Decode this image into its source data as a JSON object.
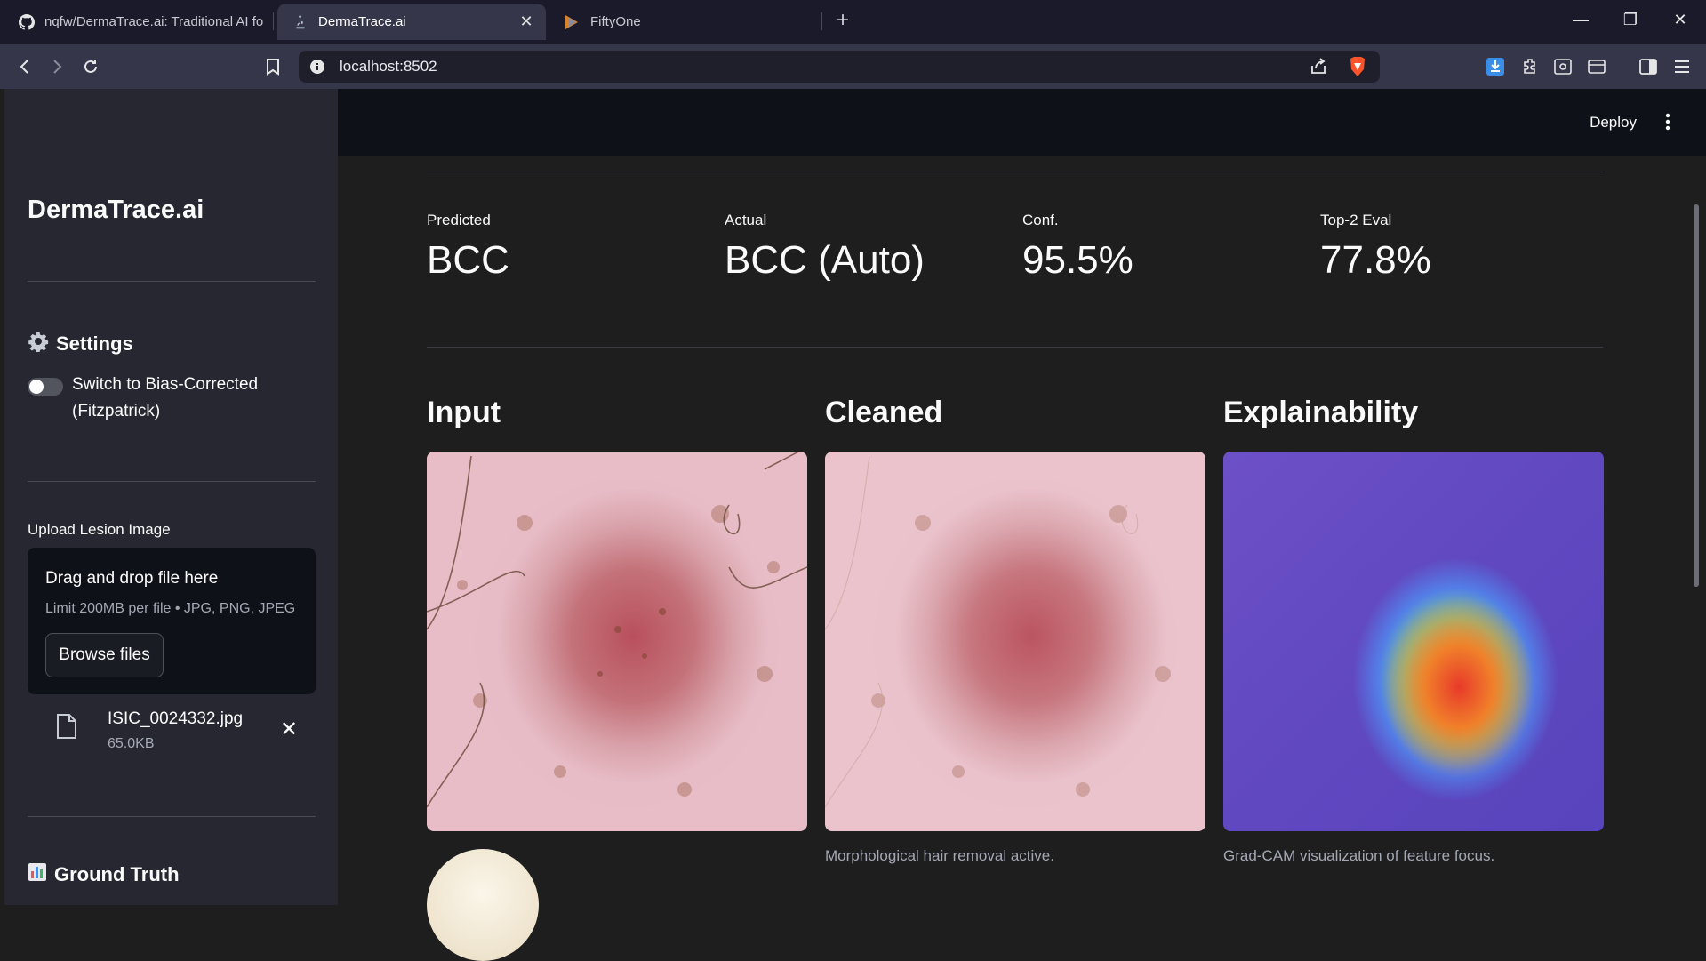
{
  "browser": {
    "tabs": [
      {
        "title": "nqfw/DermaTrace.ai: Traditional AI fo",
        "icon": "github-icon",
        "active": false
      },
      {
        "title": "DermaTrace.ai",
        "icon": "microscope-icon",
        "active": true
      },
      {
        "title": "FiftyOne",
        "icon": "fiftyone-icon",
        "active": false
      }
    ],
    "tab_close": "✕",
    "new_tab": "+",
    "url": "localhost:8502"
  },
  "sidebar": {
    "brand": "DermaTrace.ai",
    "settings_heading": "Settings",
    "bias_toggle_label": "Switch to Bias-Corrected (Fitzpatrick)",
    "bias_toggle_on": false,
    "upload_label": "Upload Lesion Image",
    "dropzone_title": "Drag and drop file here",
    "dropzone_limit": "Limit 200MB per file • JPG, PNG, JPEG",
    "browse_label": "Browse files",
    "file_name": "ISIC_0024332.jpg",
    "file_size": "65.0KB",
    "ground_truth_heading": "Ground Truth"
  },
  "header": {
    "deploy_label": "Deploy"
  },
  "metrics": [
    {
      "label": "Predicted",
      "value": "BCC"
    },
    {
      "label": "Actual",
      "value": "BCC (Auto)"
    },
    {
      "label": "Conf.",
      "value": "95.5%"
    },
    {
      "label": "Top-2 Eval",
      "value": "77.8%"
    }
  ],
  "panels": [
    {
      "title": "Input",
      "caption": ""
    },
    {
      "title": "Cleaned",
      "caption": "Morphological hair removal active."
    },
    {
      "title": "Explainability",
      "caption": "Grad-CAM visualization of feature focus."
    }
  ],
  "colors": {
    "sidebar_bg": "#262730",
    "main_bg": "#1e1e1e",
    "header_bg": "#0e1117",
    "muted_text": "#a3a8b4"
  }
}
